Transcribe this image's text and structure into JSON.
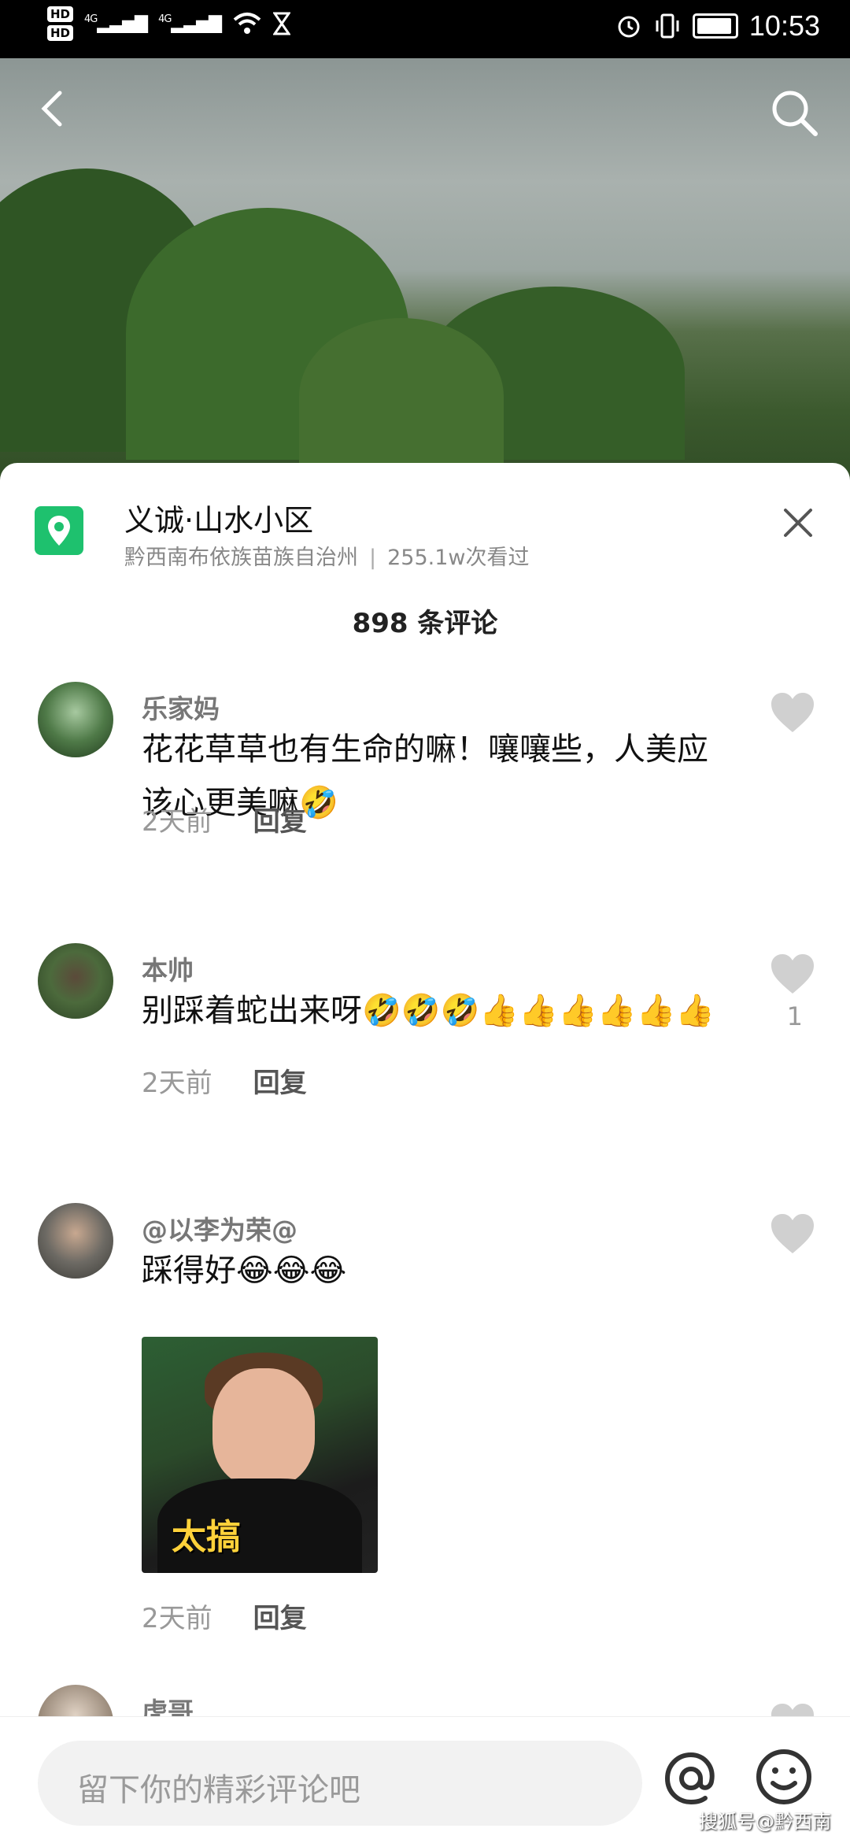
{
  "status": {
    "hd1": "HD",
    "hd2": "HD",
    "net1": "4G",
    "net2": "4G",
    "time": "10:53"
  },
  "location": {
    "title": "义诚·山水小区",
    "region": "黔西南布依族苗族自治州",
    "views": "255.1w次看过"
  },
  "comments_count": "898 条评论",
  "comments": [
    {
      "name": "乐家妈",
      "text": "花花草草也有生命的嘛！嚷嚷些，人美应该心更美嘛🤣",
      "time": "2天前",
      "reply": "回复",
      "likes": ""
    },
    {
      "name": "本帅",
      "text": "别踩着蛇出来呀🤣🤣🤣👍👍👍👍👍👍",
      "time": "2天前",
      "reply": "回复",
      "likes": "1"
    },
    {
      "name": "@以李为荣@",
      "text": "踩得好😂😂😂",
      "time": "2天前",
      "reply": "回复",
      "likes": "",
      "sticker_text": "太搞"
    },
    {
      "name": "虎哥",
      "text": "",
      "time": "",
      "reply": "",
      "likes": ""
    }
  ],
  "input": {
    "placeholder": "留下你的精彩评论吧"
  },
  "watermark": "搜狐号@黔西南",
  "colors": {
    "accent": "#1ec16e",
    "heart": "#d0d0d0"
  }
}
